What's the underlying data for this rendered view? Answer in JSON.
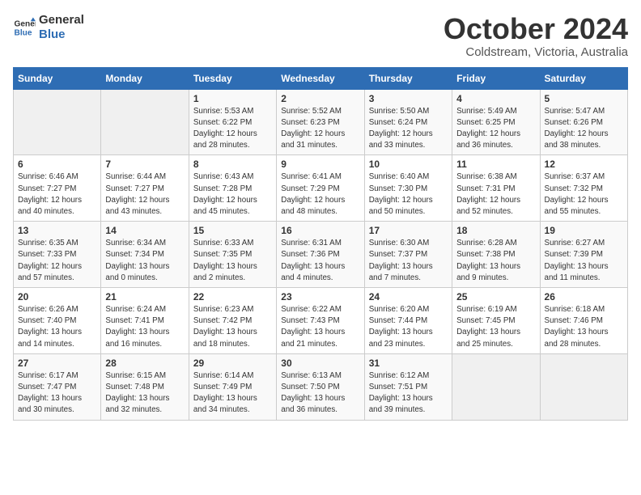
{
  "logo": {
    "line1": "General",
    "line2": "Blue"
  },
  "title": "October 2024",
  "subtitle": "Coldstream, Victoria, Australia",
  "days_of_week": [
    "Sunday",
    "Monday",
    "Tuesday",
    "Wednesday",
    "Thursday",
    "Friday",
    "Saturday"
  ],
  "weeks": [
    [
      {
        "num": "",
        "detail": ""
      },
      {
        "num": "",
        "detail": ""
      },
      {
        "num": "1",
        "detail": "Sunrise: 5:53 AM\nSunset: 6:22 PM\nDaylight: 12 hours\nand 28 minutes."
      },
      {
        "num": "2",
        "detail": "Sunrise: 5:52 AM\nSunset: 6:23 PM\nDaylight: 12 hours\nand 31 minutes."
      },
      {
        "num": "3",
        "detail": "Sunrise: 5:50 AM\nSunset: 6:24 PM\nDaylight: 12 hours\nand 33 minutes."
      },
      {
        "num": "4",
        "detail": "Sunrise: 5:49 AM\nSunset: 6:25 PM\nDaylight: 12 hours\nand 36 minutes."
      },
      {
        "num": "5",
        "detail": "Sunrise: 5:47 AM\nSunset: 6:26 PM\nDaylight: 12 hours\nand 38 minutes."
      }
    ],
    [
      {
        "num": "6",
        "detail": "Sunrise: 6:46 AM\nSunset: 7:27 PM\nDaylight: 12 hours\nand 40 minutes."
      },
      {
        "num": "7",
        "detail": "Sunrise: 6:44 AM\nSunset: 7:27 PM\nDaylight: 12 hours\nand 43 minutes."
      },
      {
        "num": "8",
        "detail": "Sunrise: 6:43 AM\nSunset: 7:28 PM\nDaylight: 12 hours\nand 45 minutes."
      },
      {
        "num": "9",
        "detail": "Sunrise: 6:41 AM\nSunset: 7:29 PM\nDaylight: 12 hours\nand 48 minutes."
      },
      {
        "num": "10",
        "detail": "Sunrise: 6:40 AM\nSunset: 7:30 PM\nDaylight: 12 hours\nand 50 minutes."
      },
      {
        "num": "11",
        "detail": "Sunrise: 6:38 AM\nSunset: 7:31 PM\nDaylight: 12 hours\nand 52 minutes."
      },
      {
        "num": "12",
        "detail": "Sunrise: 6:37 AM\nSunset: 7:32 PM\nDaylight: 12 hours\nand 55 minutes."
      }
    ],
    [
      {
        "num": "13",
        "detail": "Sunrise: 6:35 AM\nSunset: 7:33 PM\nDaylight: 12 hours\nand 57 minutes."
      },
      {
        "num": "14",
        "detail": "Sunrise: 6:34 AM\nSunset: 7:34 PM\nDaylight: 13 hours\nand 0 minutes."
      },
      {
        "num": "15",
        "detail": "Sunrise: 6:33 AM\nSunset: 7:35 PM\nDaylight: 13 hours\nand 2 minutes."
      },
      {
        "num": "16",
        "detail": "Sunrise: 6:31 AM\nSunset: 7:36 PM\nDaylight: 13 hours\nand 4 minutes."
      },
      {
        "num": "17",
        "detail": "Sunrise: 6:30 AM\nSunset: 7:37 PM\nDaylight: 13 hours\nand 7 minutes."
      },
      {
        "num": "18",
        "detail": "Sunrise: 6:28 AM\nSunset: 7:38 PM\nDaylight: 13 hours\nand 9 minutes."
      },
      {
        "num": "19",
        "detail": "Sunrise: 6:27 AM\nSunset: 7:39 PM\nDaylight: 13 hours\nand 11 minutes."
      }
    ],
    [
      {
        "num": "20",
        "detail": "Sunrise: 6:26 AM\nSunset: 7:40 PM\nDaylight: 13 hours\nand 14 minutes."
      },
      {
        "num": "21",
        "detail": "Sunrise: 6:24 AM\nSunset: 7:41 PM\nDaylight: 13 hours\nand 16 minutes."
      },
      {
        "num": "22",
        "detail": "Sunrise: 6:23 AM\nSunset: 7:42 PM\nDaylight: 13 hours\nand 18 minutes."
      },
      {
        "num": "23",
        "detail": "Sunrise: 6:22 AM\nSunset: 7:43 PM\nDaylight: 13 hours\nand 21 minutes."
      },
      {
        "num": "24",
        "detail": "Sunrise: 6:20 AM\nSunset: 7:44 PM\nDaylight: 13 hours\nand 23 minutes."
      },
      {
        "num": "25",
        "detail": "Sunrise: 6:19 AM\nSunset: 7:45 PM\nDaylight: 13 hours\nand 25 minutes."
      },
      {
        "num": "26",
        "detail": "Sunrise: 6:18 AM\nSunset: 7:46 PM\nDaylight: 13 hours\nand 28 minutes."
      }
    ],
    [
      {
        "num": "27",
        "detail": "Sunrise: 6:17 AM\nSunset: 7:47 PM\nDaylight: 13 hours\nand 30 minutes."
      },
      {
        "num": "28",
        "detail": "Sunrise: 6:15 AM\nSunset: 7:48 PM\nDaylight: 13 hours\nand 32 minutes."
      },
      {
        "num": "29",
        "detail": "Sunrise: 6:14 AM\nSunset: 7:49 PM\nDaylight: 13 hours\nand 34 minutes."
      },
      {
        "num": "30",
        "detail": "Sunrise: 6:13 AM\nSunset: 7:50 PM\nDaylight: 13 hours\nand 36 minutes."
      },
      {
        "num": "31",
        "detail": "Sunrise: 6:12 AM\nSunset: 7:51 PM\nDaylight: 13 hours\nand 39 minutes."
      },
      {
        "num": "",
        "detail": ""
      },
      {
        "num": "",
        "detail": ""
      }
    ]
  ]
}
